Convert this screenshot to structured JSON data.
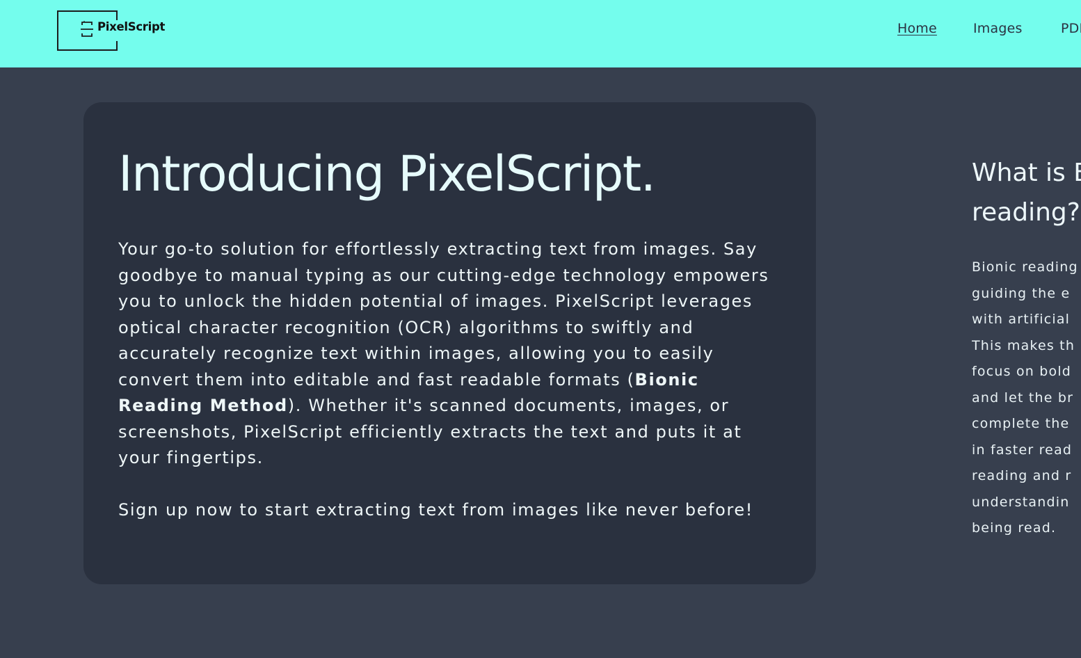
{
  "header": {
    "logo_text": "PixelScript",
    "nav": [
      {
        "label": "Home",
        "active": true
      },
      {
        "label": "Images",
        "active": false
      },
      {
        "label": "PDF",
        "active": false
      }
    ]
  },
  "intro": {
    "title": "Introducing PixelScript.",
    "paragraph_before_bold": "Your go-to solution for effortlessly extracting text from images. Say goodbye to manual typing as our cutting-edge technology empowers you to unlock the hidden potential of images. PixelScript leverages optical character recognition (OCR) algorithms to swiftly and accurately recognize text within images, allowing you to easily convert them into editable and fast readable formats (",
    "bold_text": "Bionic Reading Method",
    "paragraph_after_bold": "). Whether it's scanned documents, images, or screenshots, PixelScript efficiently extracts the text and puts it at your fingertips.",
    "signup_text": "Sign up now to start extracting text from images like never before!"
  },
  "side": {
    "title_line1": "What is B",
    "title_line2": "reading?",
    "body_lines": [
      "Bionic reading",
      "guiding the e",
      "with artificial",
      "This makes th",
      "focus on bold",
      "and let the br",
      "complete the",
      "in faster read",
      "reading and r",
      "understandin",
      "being read."
    ]
  },
  "colors": {
    "header_bg": "#74fded",
    "page_bg": "#373f4e",
    "card_bg": "#2a313f",
    "text_light": "#eef6f7"
  }
}
